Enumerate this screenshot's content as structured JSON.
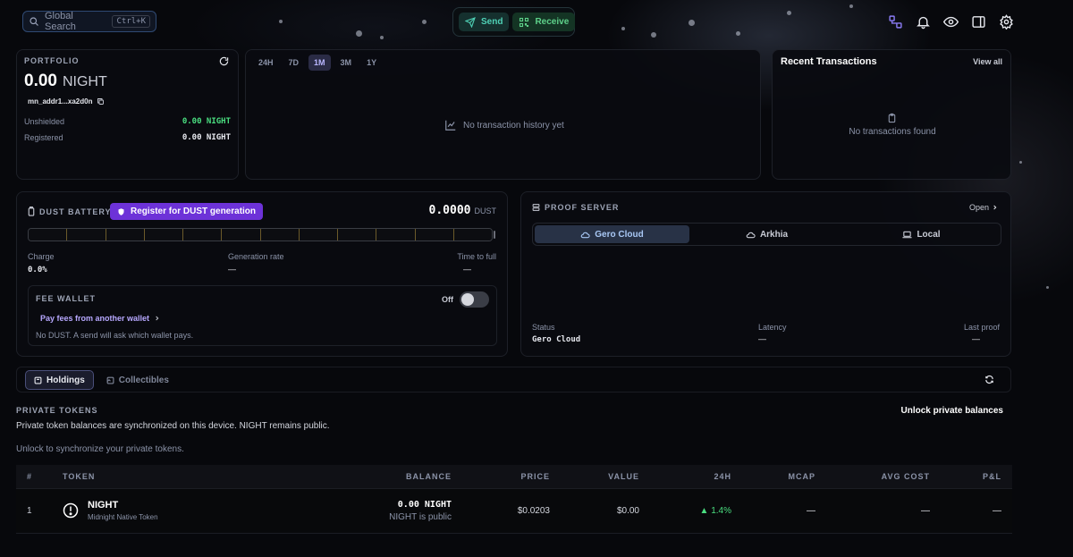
{
  "header": {
    "search_placeholder": "Global Search",
    "search_shortcut": "Ctrl+K",
    "send_label": "Send",
    "receive_label": "Receive"
  },
  "portfolio": {
    "label": "PORTFOLIO",
    "amount": "0.00",
    "unit": "NIGHT",
    "address": "mn_addr1...xa2d0n",
    "unshielded_label": "Unshielded",
    "unshielded_value": "0.00 NIGHT",
    "registered_label": "Registered",
    "registered_value": "0.00 NIGHT"
  },
  "chart_panel": {
    "timeframes": [
      "24H",
      "7D",
      "1M",
      "3M",
      "1Y"
    ],
    "active_timeframe": "1M",
    "empty_text": "No transaction history yet"
  },
  "transactions": {
    "title": "Recent Transactions",
    "view_all": "View all",
    "empty_text": "No transactions found"
  },
  "dust": {
    "label": "DUST BATTERY",
    "register_label": "Register for DUST generation",
    "amount": "0.0000",
    "unit": "DUST",
    "battery_cells": 12,
    "charge_level": 0,
    "charge_label": "Charge",
    "charge_value": "0.0%",
    "rate_label": "Generation rate",
    "rate_value": "—",
    "time_label": "Time to full",
    "time_value": "—",
    "fee_wallet_label": "FEE WALLET",
    "fee_toggle_label": "Off",
    "fee_link": "Pay fees from another wallet",
    "fee_note": "No DUST. A send will ask which wallet pays."
  },
  "proof_server": {
    "label": "PROOF SERVER",
    "open_label": "Open",
    "options": [
      "Gero Cloud",
      "Arkhia",
      "Local"
    ],
    "active_option": "Gero Cloud",
    "status_label": "Status",
    "status_value": "Gero Cloud",
    "latency_label": "Latency",
    "latency_value": "—",
    "last_proof_label": "Last proof",
    "last_proof_value": "—"
  },
  "holdings": {
    "tabs": [
      "Holdings",
      "Collectibles"
    ],
    "active_tab": "Holdings",
    "section_label": "PRIVATE TOKENS",
    "unlock_label": "Unlock private balances",
    "sync_note": "Private token balances are synchronized on this device. NIGHT remains public.",
    "unlock_note": "Unlock to synchronize your private tokens.",
    "columns": [
      "#",
      "TOKEN",
      "BALANCE",
      "PRICE",
      "VALUE",
      "24H",
      "MCAP",
      "AVG COST",
      "P&L"
    ],
    "rows": [
      {
        "index": "1",
        "name": "NIGHT",
        "subtitle": "Midnight Native Token",
        "balance": "0.00 NIGHT",
        "balance_note": "NIGHT is public",
        "price": "$0.0203",
        "value": "$0.00",
        "change": "▲ 1.4%",
        "mcap": "—",
        "avg_cost": "—",
        "pnl": "—"
      }
    ]
  },
  "colors": {
    "accent_purple": "#7c3aed",
    "positive_green": "#4ade80",
    "teal": "#4fd1b6"
  }
}
